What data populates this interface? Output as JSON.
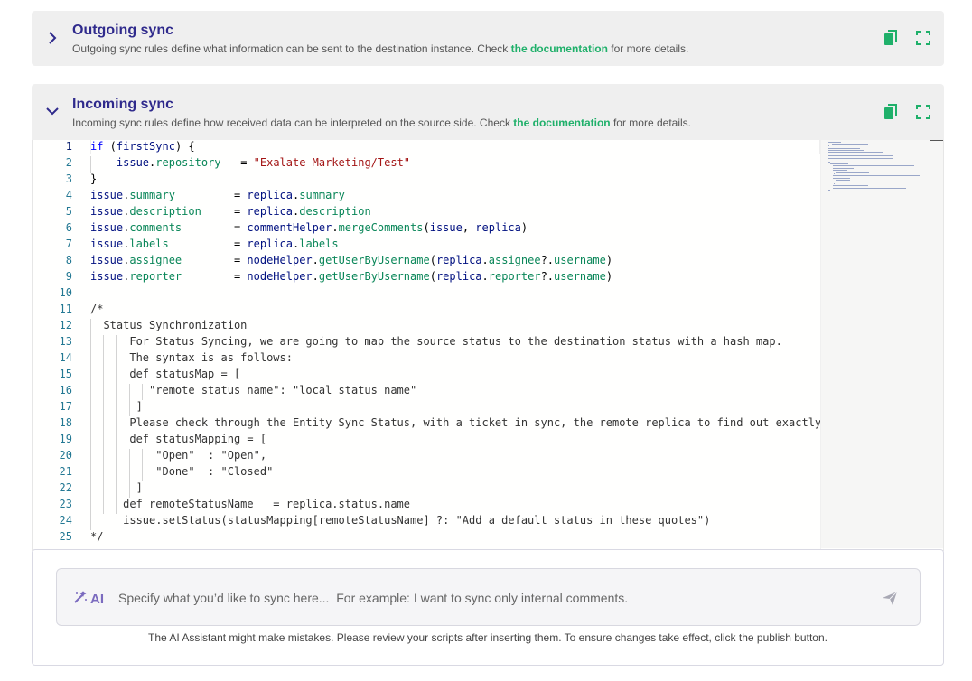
{
  "outgoing": {
    "title": "Outgoing sync",
    "desc_before": "Outgoing sync rules define what information can be sent to the destination instance. Check ",
    "doc_link": "the documentation",
    "desc_after": " for more details."
  },
  "incoming": {
    "title": "Incoming sync",
    "desc_before": "Incoming sync rules define how received data can be interpreted on the source side. Check ",
    "doc_link": "the documentation",
    "desc_after": " for more details."
  },
  "colors": {
    "title": "#2f2a8c",
    "accent_green": "#1fb06a",
    "ai_purple": "#7b6bbf"
  },
  "editor": {
    "line_numbers": [
      "1",
      "2",
      "3",
      "4",
      "5",
      "6",
      "7",
      "8",
      "9",
      "10",
      "11",
      "12",
      "13",
      "14",
      "15",
      "16",
      "17",
      "18",
      "19",
      "20",
      "21",
      "22",
      "23",
      "24",
      "25"
    ],
    "lines": [
      "if (firstSync) {",
      "    issue.repository   = \"Exalate-Marketing/Test\"",
      "}",
      "issue.summary         = replica.summary",
      "issue.description     = replica.description",
      "issue.comments        = commentHelper.mergeComments(issue, replica)",
      "issue.labels          = replica.labels",
      "issue.assignee        = nodeHelper.getUserByUsername(replica.assignee?.username)",
      "issue.reporter        = nodeHelper.getUserByUsername(replica.reporter?.username)",
      "",
      "/*",
      "  Status Synchronization",
      "      For Status Syncing, we are going to map the source status to the destination status with a hash map.",
      "      The syntax is as follows:",
      "      def statusMap = [",
      "         \"remote status name\": \"local status name\"",
      "       ]",
      "      Please check through the Entity Sync Status, with a ticket in sync, the remote replica to find out exactly",
      "      def statusMapping = [",
      "          \"Open\"  : \"Open\",",
      "          \"Done\"  : \"Closed\"",
      "       ]",
      "     def remoteStatusName   = replica.status.name",
      "     issue.setStatus(statusMapping[remoteStatusName] ?: \"Add a default status in these quotes\")",
      "*/"
    ]
  },
  "ai": {
    "badge": "AI",
    "placeholder": "Specify what you’d like to sync here...  For example: I want to sync only internal comments.",
    "note": "The AI Assistant might make mistakes. Please review your scripts after inserting them. To ensure changes take effect, click the publish button."
  }
}
